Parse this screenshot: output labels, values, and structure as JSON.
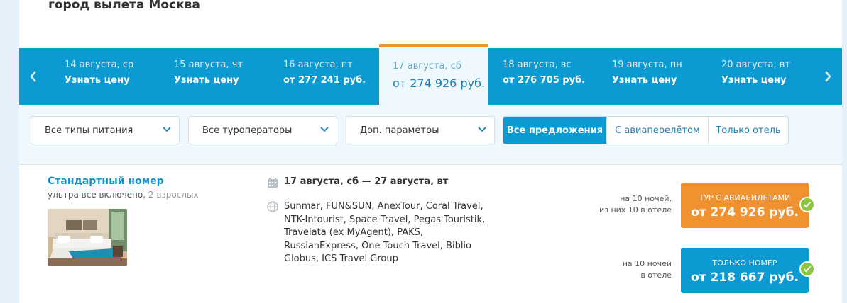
{
  "header": {
    "heading": "город вылета Москва"
  },
  "date_nav": {
    "prev_icon": "chevron-left-icon",
    "next_icon": "chevron-right-icon",
    "dates": [
      {
        "date": "14 августа, ср",
        "price": "Узнать цену"
      },
      {
        "date": "15 августа, чт",
        "price": "Узнать цену"
      },
      {
        "date": "16 августа, пт",
        "price": "от 277 241 руб."
      },
      {
        "date": "17 августа, сб",
        "price": "от 274 926 руб.",
        "active": true
      },
      {
        "date": "18 августа, вс",
        "price": "от 276 705 руб."
      },
      {
        "date": "19 августа, пн",
        "price": "Узнать цену"
      },
      {
        "date": "20 августа, вт",
        "price": "Узнать цену"
      }
    ]
  },
  "filters": {
    "meal_type": "Все типы питания",
    "operators": "Все туроператоры",
    "extra_params": "Доп. параметры",
    "offer_toggle": {
      "all": "Все предложения",
      "with_flight": "С авиаперелётом",
      "hotel_only": "Только отель",
      "selected": "all"
    }
  },
  "offer": {
    "room_name": "Стандартный номер",
    "meal": "ультра все включено, ",
    "guests": "2 взрослых",
    "dates": "17 августа, сб — 27 августа, вт",
    "operators": "Sunmar, FUN&SUN, AnexTour, Coral Travel, NTK-Intourist, Space Travel, Pegas Touristik, Travelata (ex MyAgent), PAKS, RussianExpress, One Touch Travel, Biblio Globus, ICS Travel Group",
    "tour": {
      "nights_line1": "на 10 ночей,",
      "nights_line2": "из них 10 в отеле",
      "kind": "ТУР С АВИАБИЛЕТАМИ",
      "price": "от 274 926 руб."
    },
    "room_only": {
      "nights_line1": "на 10 ночей",
      "nights_line2": "в отеле",
      "kind": "ТОЛЬКО НОМЕР",
      "price": "от 218 667 руб."
    }
  },
  "colors": {
    "primary": "#0b9ad1",
    "accent": "#f0922f",
    "check": "#8cc63f",
    "band": "#eff8fd"
  }
}
